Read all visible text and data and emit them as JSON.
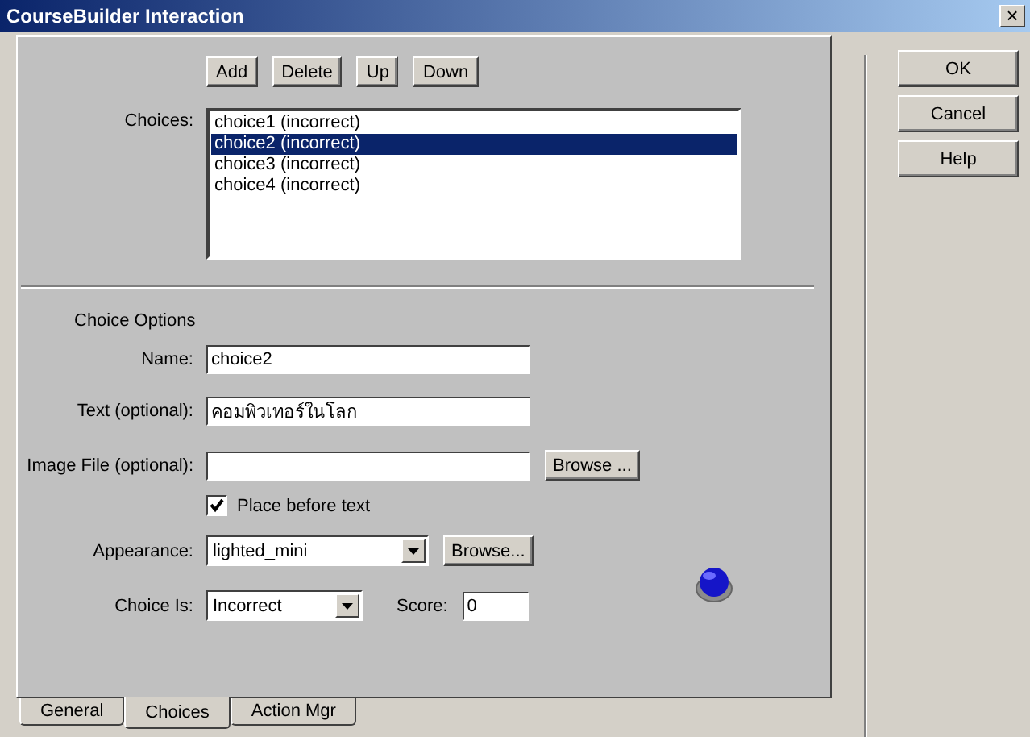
{
  "window": {
    "title": "CourseBuilder Interaction",
    "close": "×"
  },
  "list_buttons": [
    "Add",
    "Delete",
    "Up",
    "Down"
  ],
  "choices_label": "Choices:",
  "choices": [
    {
      "label": "choice1 (incorrect)",
      "selected": false
    },
    {
      "label": "choice2 (incorrect)",
      "selected": true
    },
    {
      "label": "choice3 (incorrect)",
      "selected": false
    },
    {
      "label": "choice4 (incorrect)",
      "selected": false
    }
  ],
  "section_title": "Choice Options",
  "name": {
    "label": "Name:",
    "value": "choice2"
  },
  "text": {
    "label": "Text (optional):",
    "value": "คอมพิวเทอร์ในโลก"
  },
  "image_file": {
    "label": "Image File (optional):",
    "browse": "Browse ..."
  },
  "place_before": {
    "label": "Place before text",
    "checked": true
  },
  "appearance": {
    "label": "Appearance:",
    "value": "lighted_mini",
    "browse": "Browse..."
  },
  "choice_is": {
    "label": "Choice Is:",
    "value": "Incorrect"
  },
  "score": {
    "label": "Score:",
    "value": "0"
  },
  "tabs": [
    {
      "label": "General",
      "selected": false
    },
    {
      "label": "Choices",
      "selected": true
    },
    {
      "label": "Action Mgr",
      "selected": false
    }
  ],
  "dialog_buttons": [
    "OK",
    "Cancel",
    "Help"
  ]
}
